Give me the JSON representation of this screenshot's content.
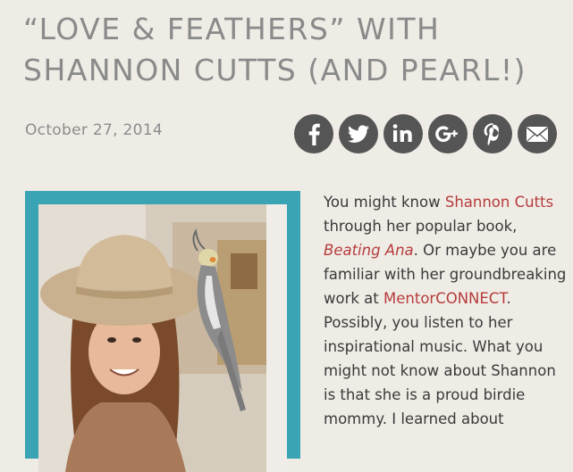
{
  "post": {
    "title": "“Love & Feathers” with Shannon Cutts (and Pearl!)",
    "date": "October 27, 2014"
  },
  "share": {
    "buttons": [
      {
        "name": "facebook",
        "icon": "facebook-icon"
      },
      {
        "name": "twitter",
        "icon": "twitter-icon"
      },
      {
        "name": "linkedin",
        "icon": "linkedin-icon"
      },
      {
        "name": "google-plus",
        "icon": "google-plus-icon"
      },
      {
        "name": "pinterest",
        "icon": "pinterest-icon"
      },
      {
        "name": "email",
        "icon": "email-icon"
      }
    ]
  },
  "article": {
    "t1": "You might know ",
    "link_shannon": "Shannon Cutts",
    "t2": " through her popular book, ",
    "link_book": "Beating Ana",
    "t3": ". Or maybe you are familiar with her groundbreaking work at ",
    "link_mentor": "MentorCONNECT",
    "t4": ". Possibly, you listen to her inspirational music. What you might not know about Shannon is that she is a proud birdie mommy. I learned about"
  },
  "colors": {
    "background": "#efece6",
    "title": "#8a8a8a",
    "link": "#b63b3b",
    "frame": "#3aa3b4",
    "share_button": "#555555"
  }
}
